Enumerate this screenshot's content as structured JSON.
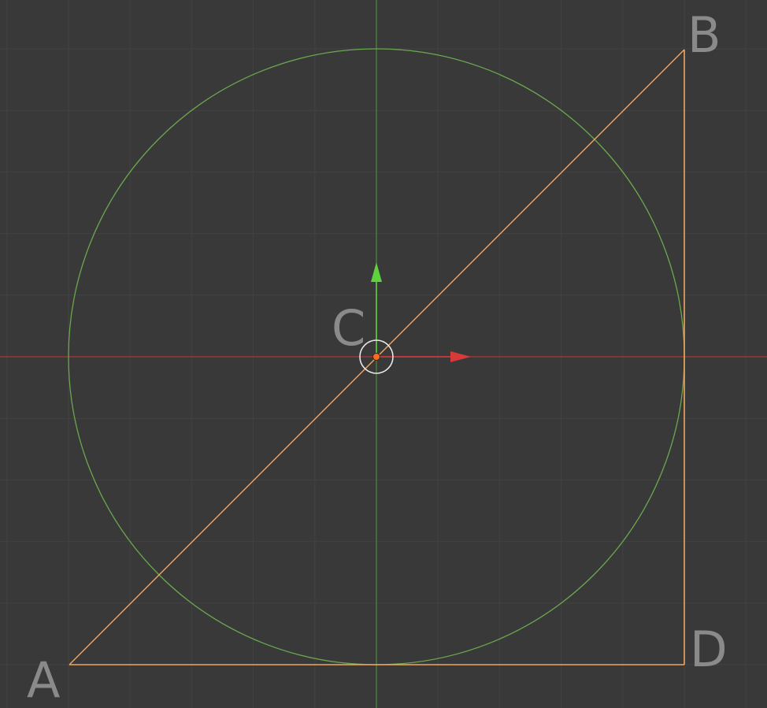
{
  "viewport": {
    "background_color": "#393939",
    "grid_color": "#424242",
    "x_axis_color": "#b03434",
    "y_axis_color": "#4e8a3a"
  },
  "gizmo": {
    "x_arrow_color": "#d83a3a",
    "y_arrow_color": "#5fd13d",
    "origin_dot_color": "#ff6a1c",
    "cursor_ring_color": "#e8e8e8"
  },
  "mesh": {
    "edge_color": "#f0a660",
    "circle_color": "#6aa84f"
  },
  "labels": {
    "a": "A",
    "b": "B",
    "c": "C",
    "d": "D"
  },
  "icons": {
    "cursor": "3d-cursor-icon",
    "x_arrow": "x-arrow-icon",
    "y_arrow": "y-arrow-icon"
  }
}
